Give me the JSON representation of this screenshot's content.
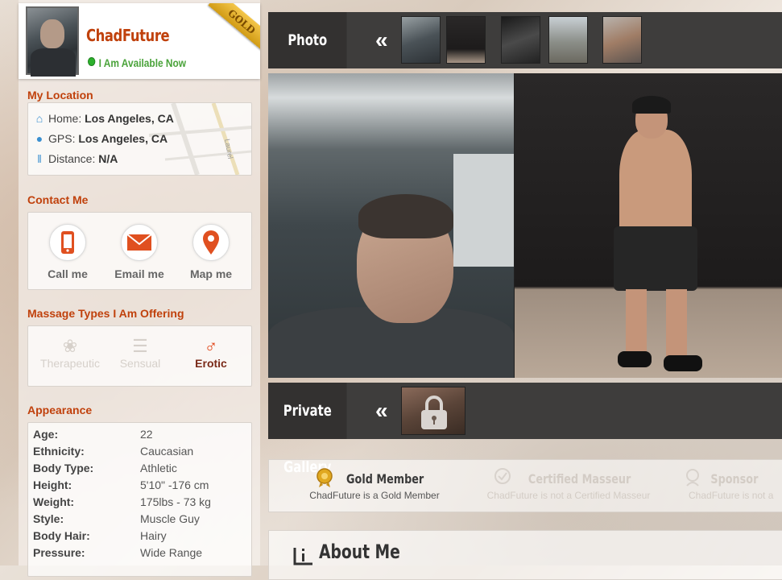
{
  "profile": {
    "name": "ChadFuture",
    "availability": "I Am Available Now",
    "membership_ribbon": "GOLD"
  },
  "location": {
    "title": "My Location",
    "home_label": "Home:",
    "home_value": "Los Angeles, CA",
    "gps_label": "GPS:",
    "gps_value": "Los Angeles, CA",
    "distance_label": "Distance:",
    "distance_value": "N/A",
    "map_street": "Laurel"
  },
  "contact": {
    "title": "Contact Me",
    "call": "Call me",
    "email": "Email me",
    "map": "Map me"
  },
  "massage": {
    "title": "Massage Types I Am Offering",
    "types": [
      {
        "label": "Therapeutic",
        "active": false,
        "icon": "lotus-icon"
      },
      {
        "label": "Sensual",
        "active": false,
        "icon": "stones-icon"
      },
      {
        "label": "Erotic",
        "active": true,
        "icon": "male-symbol-icon"
      }
    ]
  },
  "appearance": {
    "title": "Appearance",
    "rows": [
      {
        "key": "Age:",
        "value": "22"
      },
      {
        "key": "Ethnicity:",
        "value": "Caucasian"
      },
      {
        "key": "Body Type:",
        "value": "Athletic"
      },
      {
        "key": "Height:",
        "value": "5'10\" -176 cm"
      },
      {
        "key": "Weight:",
        "value": "175lbs - 73 kg"
      },
      {
        "key": "Style:",
        "value": "Muscle Guy"
      },
      {
        "key": "Body Hair:",
        "value": "Hairy"
      },
      {
        "key": "Pressure:",
        "value": "Wide Range"
      }
    ]
  },
  "gallery": {
    "photo_title": "Photo Gallery",
    "private_title": "Private Gallery",
    "prev_arrow": "«"
  },
  "badges": [
    {
      "title": "Gold Member",
      "sub": "ChadFuture is a Gold Member",
      "active": true
    },
    {
      "title": "Certified Masseur",
      "sub": "ChadFuture is not a Certified Masseur",
      "active": false
    },
    {
      "title": "Sponsor",
      "sub": "ChadFuture is not a",
      "active": false
    }
  ],
  "about": {
    "title": "About Me"
  },
  "colors": {
    "accent": "#c0410c",
    "available": "#2cb02c",
    "gold": "#e0a820"
  }
}
